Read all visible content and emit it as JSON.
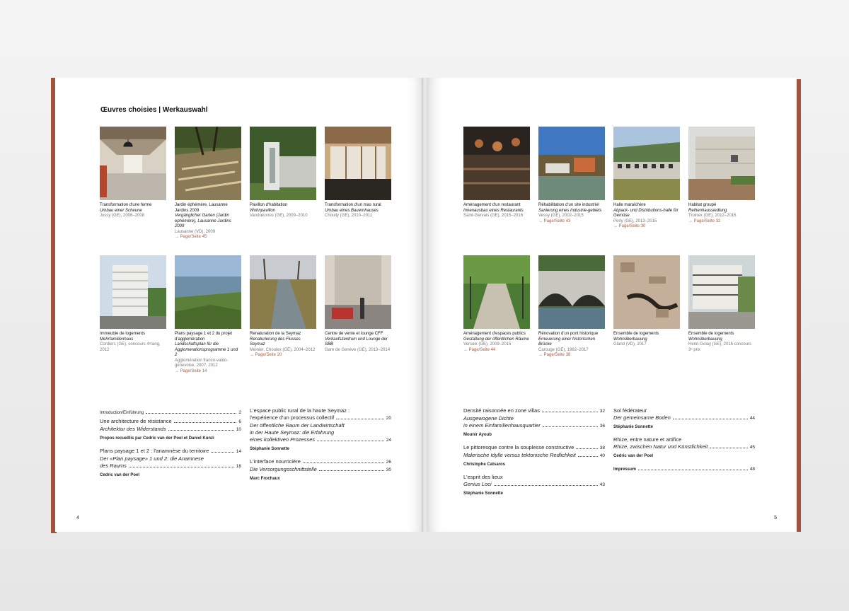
{
  "left": {
    "title": "Œuvres choisies | Werkauswahl",
    "page_number": "4",
    "projects": [
      {
        "t": "Transformation d'une ferme",
        "g": "Umbau einer Scheune",
        "m": "Jussy (GE), 2006–2008",
        "p": ""
      },
      {
        "t": "Jardin éphémère, Lausanne Jardins 2009",
        "g": "Vergänglicher Garten (Jardin ephémère), Lausanne Jardins 2009",
        "m": "Lausanne (VD), 2009",
        "p": "→ Page/Seite 45"
      },
      {
        "t": "Pavillon d'habitation",
        "g": "Wohnpavillon",
        "m": "Vandœuvres (GE), 2009–2010",
        "p": ""
      },
      {
        "t": "Transformation d'un mas rural",
        "g": "Umbau eines Bauernhauses",
        "m": "Choully (GE), 2010–2011",
        "p": ""
      },
      {
        "t": "Immeuble de logements",
        "g": "Mehrfamilienhaus",
        "m": "Cordiers (GE), concours 4ᵉrang, 2012",
        "p": ""
      },
      {
        "t": "Plans paysage 1 et 2 du projet d'agglomération",
        "g": "Landschaftsplan für die Agglomerationsprogramme 1 und 2",
        "m": "Agglomération franco-valdo-genevoise, 2007, 2012",
        "p": "→ Page/Seite 14"
      },
      {
        "t": "Renaturation de la Seymaz",
        "g": "Renaturierung des Flusses Seymaz",
        "m": "Meinier, Choulex (GE), 2004–2012",
        "p": "→ Page/Seite 20"
      },
      {
        "t": "Centre de vente et lounge CFF",
        "g": "Verkaufszentrum und Lounge der SBB",
        "m": "Gare de Genève (GE), 2013–2014",
        "p": ""
      }
    ],
    "toc1": {
      "intro": "Introduction/Einführung",
      "intro_pg": "2",
      "a1": "Une architecture de résistance",
      "a1_pg": "6",
      "a2": "Architektur des Widerstands",
      "a2_pg": "10",
      "a_au": "Propos recueillis par Cedric van der Poel et Daniel Kunzi",
      "b1": "Plans paysage 1 et 2 : l'anamnèse du territoire",
      "b1_pg": "14",
      "b2": "Der «Plan paysage» 1 und 2: die Anamnese",
      "b3": "des Raums",
      "b3_pg": "18",
      "b_au": "Cedric van der Poel"
    },
    "toc2": {
      "c1": "L'espace public rural de la haute Seymaz :",
      "c2": "l'expérience d'un processus collectif",
      "c2_pg": "20",
      "c3": "Der öffentliche Raum der Landwirtschaft",
      "c4": "in der Haute Seymaz: die Erfahrung",
      "c5": "eines kollektiven Prozesses",
      "c5_pg": "24",
      "c_au": "Stéphanie Sonnette",
      "d1": "L'interface nourricière",
      "d1_pg": "26",
      "d2": "Die Versorgungsschnittstelle",
      "d2_pg": "30",
      "d_au": "Marc Frochaux"
    }
  },
  "right": {
    "page_number": "5",
    "projects": [
      {
        "t": "Aménagement d'un restaurant",
        "g": "Innenausbau eines Restaurants",
        "m": "Saint-Gervais (GE), 2015–2016",
        "p": ""
      },
      {
        "t": "Réhabilitation d'un site industriel",
        "g": "Sanierung eines Industrie-gebiets",
        "m": "Vessy (GE), 2002–2015",
        "p": "→ Page/Seite 43"
      },
      {
        "t": "Halle maraîchère",
        "g": "Abpack- und Distributions-halle für Gemüse",
        "m": "Perly (GE), 2013–2015",
        "p": "→ Page/Seite 30"
      },
      {
        "t": "Habitat groupé",
        "g": "Reihenhaussiedlung",
        "m": "Troinex (GE), 2012–2016",
        "p": "→ Page/Seite 32"
      },
      {
        "t": "Aménagement d'espaces publics",
        "g": "Gestaltung der öffentlichen Räume",
        "m": "Versoix (GE), 2009–2015",
        "p": "→ Page/Seite 44"
      },
      {
        "t": "Rénovation d'un pont historique",
        "g": "Erneuerung einer historischen Brücke",
        "m": "Carouge (GE), 1982–2017",
        "p": "→ Page/Seite 38"
      },
      {
        "t": "Ensemble de logements",
        "g": "Wohnüberbauung",
        "m": "Gland (VD), 2017",
        "p": ""
      },
      {
        "t": "Ensemble de logements",
        "g": "Wohnüberbauung",
        "m": "Henri-Golay (GE), 2016 concours 3ᵉ prix",
        "p": ""
      }
    ],
    "toc3": {
      "e1": "Densité raisonnée en zone villas",
      "e1_pg": "32",
      "e2": "Ausgewogene Dichte",
      "e3": "in einem Einfamilienhausquartier",
      "e3_pg": "36",
      "e_au": "Mounir Ayoub",
      "f1": "Le pittoresque contre la souplesse constructive",
      "f1_pg": "38",
      "f2": "Malerische Idylle versus tektonische Redlichkeit",
      "f2_pg": "40",
      "f_au": "Christophe Catsaros",
      "g1": "L'esprit des lieux",
      "g2": "Genius Loci",
      "g2_pg": "43",
      "g_au": "Stéphanie Sonnette"
    },
    "toc4": {
      "h1": "Sol fédérateur",
      "h2": "Der gemeinsame Boden",
      "h2_pg": "44",
      "h_au": "Stéphanie Sonnette",
      "i1": "Rhize, entre nature et artifice",
      "i2": "Rhize, zwischen Natur und Künstlichkeit",
      "i2_pg": "45",
      "i_au": "Cedric van der Poel",
      "j1": "Impressum",
      "j1_pg": "48"
    }
  }
}
